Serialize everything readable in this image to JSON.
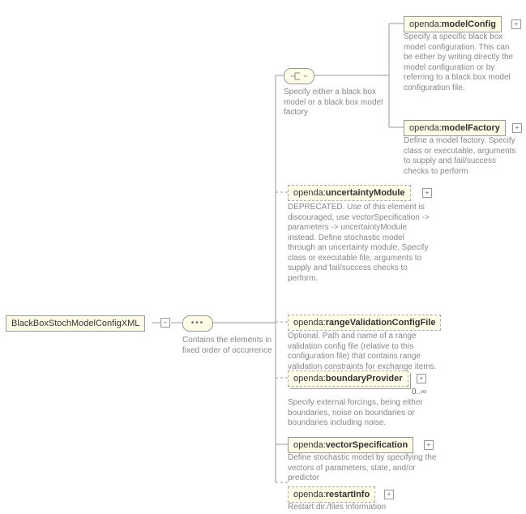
{
  "root": {
    "label": "BlackBoxStochModelConfigXML"
  },
  "sequence": {
    "desc": "Contains the elements in fixed order of occurrence"
  },
  "choice": {
    "desc": "Specify either a black box model or a black box model factory"
  },
  "modelConfig": {
    "label_prefix": "openda:",
    "label_name": "modelConfig",
    "desc": "Specify a specific black box model configuration. This can be either by writing directly the model configuration or by referring to a black box model configuration file."
  },
  "modelFactory": {
    "label_prefix": "openda:",
    "label_name": "modelFactory",
    "desc": "Define a model factory. Specify class or executable, arguments to supply and fail/success checks to perform"
  },
  "uncertaintyModule": {
    "label_prefix": "openda:",
    "label_name": "uncertaintyModule",
    "desc": "DEPRECATED. Use of this element is discouraged, use vectorSpecification -> parameters -> uncertaintyModule instead. Define stochastic model through an uncertainty module. Specify class or executable file, arguments to supply and fail/success checks to perform."
  },
  "rangeValidationConfigFile": {
    "label_prefix": "openda:",
    "label_name": "rangeValidationConfigFile",
    "desc": "Optional. Path and name of a range validation config file (relative to this configuration file) that contains range validation constraints for exchange items."
  },
  "boundaryProvider": {
    "label_prefix": "openda:",
    "label_name": "boundaryProvider",
    "mult": "0..∞",
    "desc": "Specify external forcings, being either boundaries, noise on boundaries or boundaries including noise."
  },
  "vectorSpecification": {
    "label_prefix": "openda:",
    "label_name": "vectorSpecification",
    "desc": "Define stochastic model by specifying the vectors of parameters, state, and/or predictor"
  },
  "restartInfo": {
    "label_prefix": "openda:",
    "label_name": "restartInfo",
    "desc": "Restart dir./files information"
  }
}
